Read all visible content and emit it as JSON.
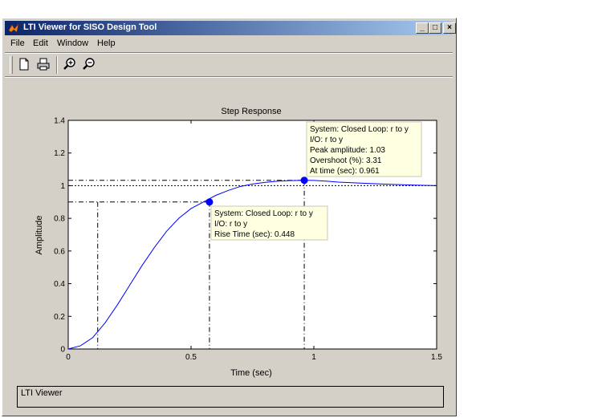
{
  "window": {
    "title": "LTI Viewer for SISO Design Tool",
    "controls": {
      "minimize": "_",
      "maximize": "□",
      "close": "×"
    }
  },
  "menu": {
    "file": "File",
    "edit": "Edit",
    "window": "Window",
    "help": "Help"
  },
  "toolbar": {
    "icons": [
      "new-file-icon",
      "print-icon",
      "zoom-in-icon",
      "zoom-out-icon"
    ]
  },
  "chart_data": {
    "type": "line",
    "title": "Step Response",
    "xlabel": "Time (sec)",
    "ylabel": "Amplitude",
    "xlim": [
      0,
      1.5
    ],
    "ylim": [
      0,
      1.4
    ],
    "xticks": [
      "0",
      "0.5",
      "1",
      "1.5"
    ],
    "yticks": [
      "0",
      "0.2",
      "0.4",
      "0.6",
      "0.8",
      "1",
      "1.2",
      "1.4"
    ],
    "series": [
      {
        "color": "#0000ff",
        "x": [
          0,
          0.05,
          0.1,
          0.15,
          0.2,
          0.25,
          0.3,
          0.35,
          0.4,
          0.45,
          0.5,
          0.55,
          0.6,
          0.65,
          0.7,
          0.75,
          0.8,
          0.85,
          0.9,
          0.961,
          1.0,
          1.05,
          1.1,
          1.2,
          1.3,
          1.4,
          1.5
        ],
        "y": [
          0,
          0.02,
          0.07,
          0.16,
          0.27,
          0.39,
          0.51,
          0.62,
          0.72,
          0.8,
          0.86,
          0.9,
          0.94,
          0.97,
          0.995,
          1.01,
          1.02,
          1.027,
          1.031,
          1.033,
          1.032,
          1.028,
          1.022,
          1.015,
          1.009,
          1.004,
          1.0
        ]
      }
    ],
    "reference_line": 1.0,
    "rise_time_markers": {
      "x_start": 0.12,
      "x_end": 0.575,
      "y_level": 0.9
    },
    "peak": {
      "x": 0.961,
      "y": 1.033
    },
    "rise_point": {
      "x": 0.575,
      "y": 0.9
    },
    "annotations": {
      "peak": [
        "System: Closed Loop: r to y",
        "I/O: r to y",
        "Peak amplitude: 1.03",
        "Overshoot (%): 3.31",
        "At time (sec): 0.961"
      ],
      "rise": [
        "System: Closed Loop: r to y",
        "I/O: r to y",
        "Rise Time (sec): 0.448"
      ]
    }
  },
  "status": {
    "text": "LTI Viewer"
  }
}
